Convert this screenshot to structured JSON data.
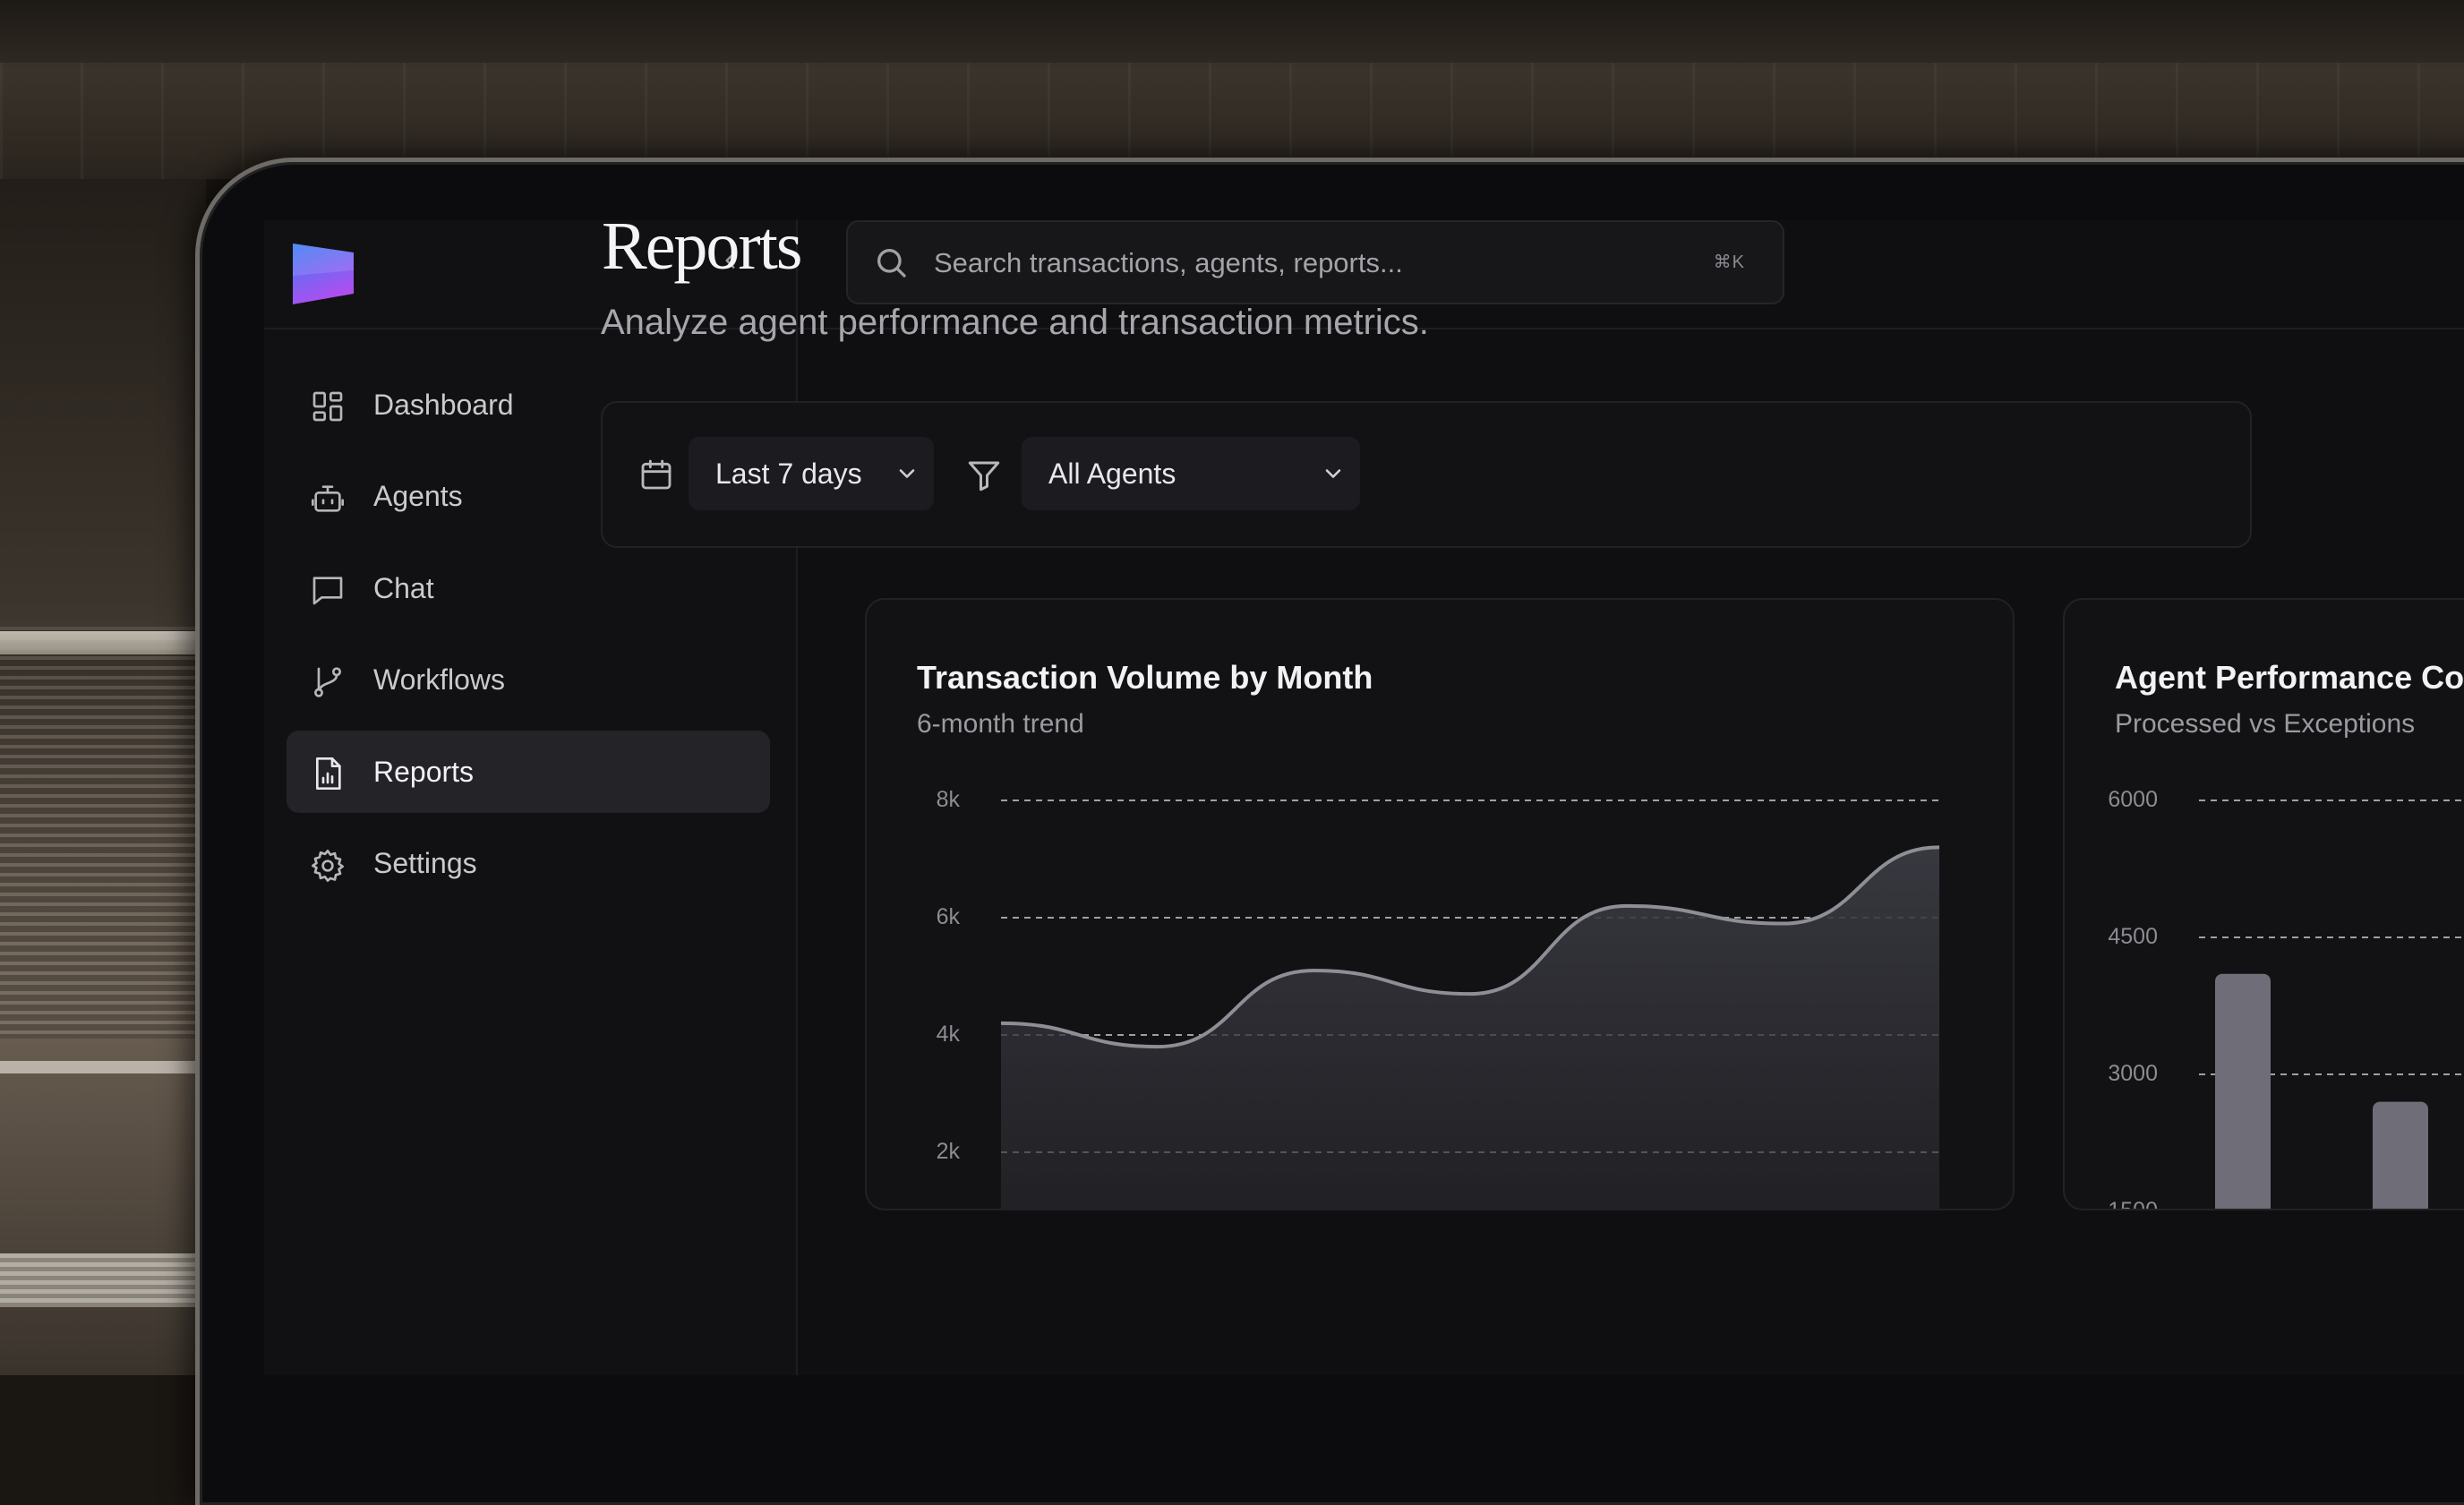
{
  "app": {
    "brand_colors": {
      "logo_top": "#3b7cf5",
      "logo_bottom": "#b04ef0",
      "accent": "#242428"
    }
  },
  "sidebar": {
    "collapse_icon": "chevron-left-icon",
    "items": [
      {
        "label": "Dashboard",
        "icon": "dashboard-grid-icon",
        "active": false
      },
      {
        "label": "Agents",
        "icon": "bot-icon",
        "active": false
      },
      {
        "label": "Chat",
        "icon": "chat-bubble-icon",
        "active": false
      },
      {
        "label": "Workflows",
        "icon": "git-branch-icon",
        "active": false
      },
      {
        "label": "Reports",
        "icon": "report-chart-icon",
        "active": true
      },
      {
        "label": "Settings",
        "icon": "gear-icon",
        "active": false
      }
    ]
  },
  "search": {
    "placeholder": "Search transactions, agents, reports...",
    "shortcut": "⌘K"
  },
  "page": {
    "title": "Reports",
    "subtitle": "Analyze agent performance and transaction metrics."
  },
  "filters": {
    "date_range": "Last 7 days",
    "agent": "All Agents"
  },
  "cards": [
    {
      "title": "Transaction Volume by Month",
      "subtitle": "6-month trend"
    },
    {
      "title": "Agent Performance Co",
      "subtitle": "Processed vs Exceptions"
    }
  ],
  "chart_data": [
    {
      "type": "area",
      "title": "Transaction Volume by Month",
      "subtitle": "6-month trend",
      "y_tick_labels": [
        "8k",
        "6k",
        "4k",
        "2k"
      ],
      "y_ticks": [
        8000,
        6000,
        4000,
        2000
      ],
      "ylim": [
        0,
        8000
      ],
      "grid": true,
      "values": [
        4200,
        3800,
        5100,
        4700,
        6200,
        5900,
        7200
      ],
      "line_color": "#8e8e96",
      "fill_color": "#2a2a30"
    },
    {
      "type": "bar",
      "title": "Agent Performance Co",
      "subtitle": "Processed vs Exceptions",
      "y_tick_labels": [
        "6000",
        "4500",
        "3000",
        "1500"
      ],
      "y_ticks": [
        6000,
        4500,
        3000,
        1500
      ],
      "ylim": [
        0,
        6000
      ],
      "grid": true,
      "values": [
        4100,
        2700
      ],
      "bar_color": "#6f6d78"
    }
  ]
}
